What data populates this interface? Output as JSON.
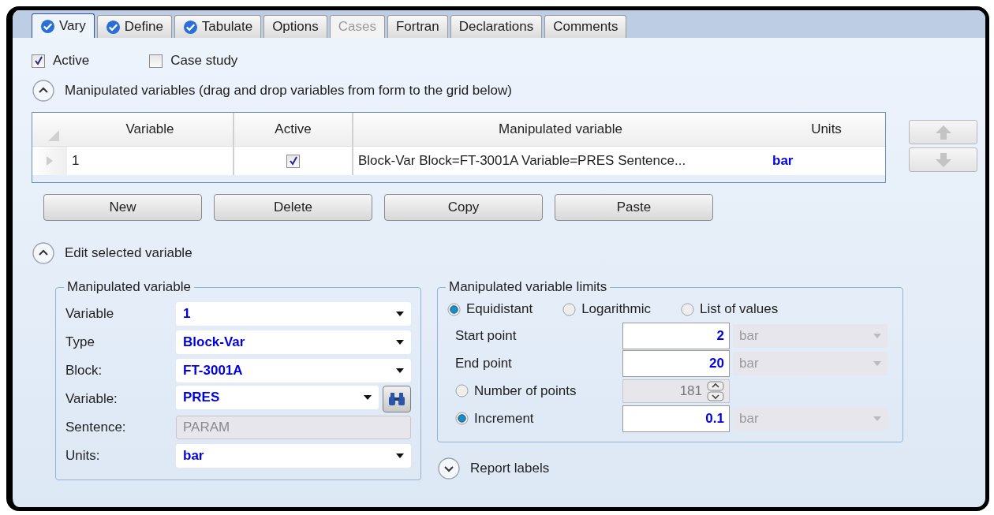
{
  "tabs": [
    {
      "label": "Vary",
      "complete": true,
      "selected": true,
      "disabled": false
    },
    {
      "label": "Define",
      "complete": true,
      "selected": false,
      "disabled": false
    },
    {
      "label": "Tabulate",
      "complete": true,
      "selected": false,
      "disabled": false
    },
    {
      "label": "Options",
      "complete": false,
      "selected": false,
      "disabled": false
    },
    {
      "label": "Cases",
      "complete": false,
      "selected": false,
      "disabled": true
    },
    {
      "label": "Fortran",
      "complete": false,
      "selected": false,
      "disabled": false
    },
    {
      "label": "Declarations",
      "complete": false,
      "selected": false,
      "disabled": false
    },
    {
      "label": "Comments",
      "complete": false,
      "selected": false,
      "disabled": false
    }
  ],
  "options": [
    {
      "label": "Active",
      "checked": true
    },
    {
      "label": "Case study",
      "checked": false
    }
  ],
  "variables_section": {
    "title": "Manipulated variables (drag and drop variables from form to the grid below)",
    "expanded": true
  },
  "grid": {
    "columns": [
      "Variable",
      "Active",
      "Manipulated variable",
      "Units"
    ],
    "rows": [
      {
        "variable": "1",
        "active": true,
        "manipulated": "Block-Var Block=FT-3001A Variable=PRES Sentence...",
        "units": "bar",
        "selected": false
      }
    ]
  },
  "buttons": [
    "New",
    "Delete",
    "Copy",
    "Paste"
  ],
  "edit_section": {
    "title": "Edit selected variable",
    "expanded": true
  },
  "variable_group": {
    "title": "Manipulated variable",
    "fields": [
      {
        "label": "Variable",
        "value": "1",
        "kind": "dropdown"
      },
      {
        "label": "Type",
        "value": "Block-Var",
        "kind": "dropdown"
      },
      {
        "label": "Block:",
        "value": "FT-3001A",
        "kind": "dropdown"
      },
      {
        "label": "Variable:",
        "value": "PRES",
        "kind": "search"
      },
      {
        "label": "Sentence:",
        "value": "PARAM",
        "kind": "readonly"
      },
      {
        "label": "Units:",
        "value": "bar",
        "kind": "dropdown"
      }
    ]
  },
  "limits_group": {
    "title": "Manipulated variable limits",
    "spacing": [
      {
        "label": "Equidistant",
        "selected": true
      },
      {
        "label": "Logarithmic",
        "selected": false
      },
      {
        "label": "List of values",
        "selected": false
      }
    ],
    "rows": [
      {
        "label": "Start point",
        "value": "2",
        "units": "bar",
        "kind": "value"
      },
      {
        "label": "End point",
        "value": "20",
        "units": "bar",
        "kind": "value"
      },
      {
        "label": "Number of points",
        "value": "181",
        "kind": "spin",
        "selected": false
      },
      {
        "label": "Increment",
        "value": "0.1",
        "units": "bar",
        "kind": "radio_value",
        "selected": true
      }
    ]
  },
  "report_section": {
    "title": "Report labels",
    "expanded": false
  }
}
